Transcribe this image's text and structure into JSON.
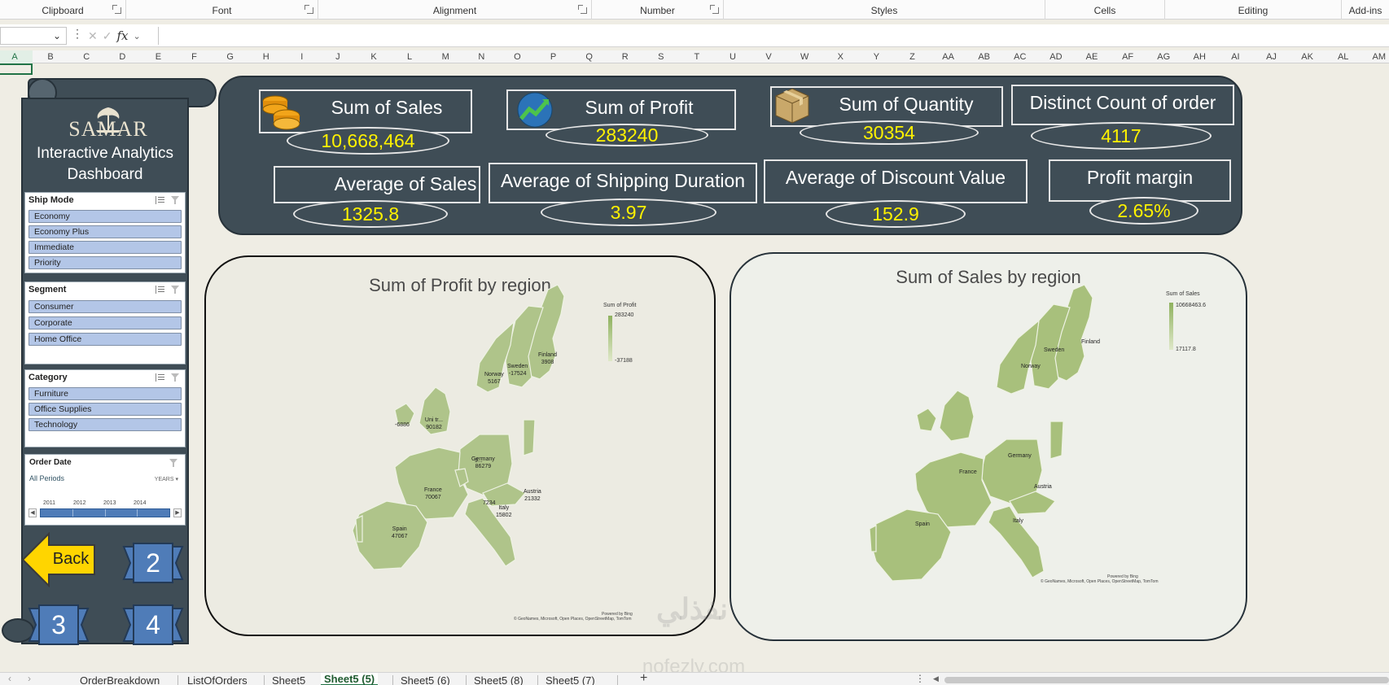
{
  "ribbon": {
    "groups": [
      "Clipboard",
      "Font",
      "Alignment",
      "Number",
      "Styles",
      "Cells",
      "Editing",
      "Add-ins"
    ]
  },
  "formula_bar": {
    "name_box_value": "",
    "formula_value": "",
    "fx_label": "fx"
  },
  "columns": [
    "A",
    "B",
    "C",
    "D",
    "E",
    "F",
    "G",
    "H",
    "I",
    "J",
    "K",
    "L",
    "M",
    "N",
    "O",
    "P",
    "Q",
    "R",
    "S",
    "T",
    "U",
    "V",
    "W",
    "X",
    "Y",
    "Z",
    "AA",
    "AB",
    "AC",
    "AD",
    "AE",
    "AF",
    "AG",
    "AH",
    "AI",
    "AJ",
    "AK",
    "AL",
    "AM"
  ],
  "selected_column": "A",
  "sidebar": {
    "logo": "SAMAR",
    "title_line1": "Interactive Analytics",
    "title_line2": "Dashboard",
    "slicers": [
      {
        "title": "Ship Mode",
        "items": [
          "Economy",
          "Economy Plus",
          "Immediate",
          "Priority"
        ]
      },
      {
        "title": "Segment",
        "items": [
          "Consumer",
          "Corporate",
          "Home Office"
        ]
      },
      {
        "title": "Category",
        "items": [
          "Furniture",
          "Office Supplies",
          "Technology"
        ]
      }
    ],
    "timeline": {
      "title": "Order Date",
      "period": "All Periods",
      "unit": "YEARS",
      "years": [
        "2011",
        "2012",
        "2013",
        "2014"
      ]
    },
    "back_label": "Back",
    "nav_buttons": [
      "2",
      "3",
      "4"
    ],
    "colors": {
      "panel": "#3f4d56",
      "slicer_item": "#b3c6e7",
      "back": "#ffd700",
      "nav": "#4f7cb8"
    }
  },
  "kpis": [
    {
      "label": "Sum of Sales",
      "value": "10,668,464",
      "icon": "coins-icon"
    },
    {
      "label": "Sum of Profit",
      "value": "283240",
      "icon": "growth-chart-icon"
    },
    {
      "label": "Sum of Quantity",
      "value": "30354",
      "icon": "box-icon"
    },
    {
      "label": "Distinct Count of order",
      "value": "4117"
    },
    {
      "label": "Average of Sales",
      "value": "1325.8"
    },
    {
      "label": "Average of Shipping Duration",
      "value": "3.97"
    },
    {
      "label": "Average of Discount Value",
      "value": "152.9"
    },
    {
      "label": "Profit margin",
      "value": "2.65%"
    }
  ],
  "maps": {
    "profit": {
      "title": "Sum of Profit by region",
      "legend_title": "Sum of Profit",
      "legend_max": "283240",
      "legend_min": "-37188",
      "labels": [
        {
          "name": "Finland",
          "value": "3908"
        },
        {
          "name": "Sweden",
          "value": "-17524"
        },
        {
          "name": "Norway",
          "value": "5167"
        },
        {
          "name": "",
          "value": "-6886"
        },
        {
          "name": "Uni tr...",
          "value": "90182"
        },
        {
          "name": "",
          "value": "9..."
        },
        {
          "name": "Germany",
          "value": "86279"
        },
        {
          "name": "France",
          "value": "70067"
        },
        {
          "name": "",
          "value": "7234"
        },
        {
          "name": "Austria",
          "value": "21332"
        },
        {
          "name": "Italy",
          "value": "15802"
        },
        {
          "name": "Spain",
          "value": "47067"
        }
      ],
      "powered": "Powered by Bing",
      "attribution": "© GeoNames, Microsoft, Open Places, OpenStreetMap, TomTom"
    },
    "sales": {
      "title": "Sum of Sales by region",
      "legend_title": "Sum of Sales",
      "legend_max": "10668463.6",
      "legend_min": "17117.8",
      "labels": [
        "Finland",
        "Sweden",
        "Norway",
        "Germany",
        "France",
        "Austria",
        "Italy",
        "Spain"
      ],
      "powered": "Powered by Bing",
      "attribution": "© GeoNames, Microsoft, Open Places, OpenStreetMap, TomTom"
    }
  },
  "sheet_tabs": [
    "OrderBreakdown",
    "ListOfOrders",
    "Sheet5",
    "Sheet5 (5)",
    "Sheet5 (6)",
    "Sheet5 (8)",
    "Sheet5 (7)"
  ],
  "active_tab": "Sheet5 (5)",
  "watermark": {
    "line1": "نفذلي",
    "line2": "nofezly.com"
  }
}
